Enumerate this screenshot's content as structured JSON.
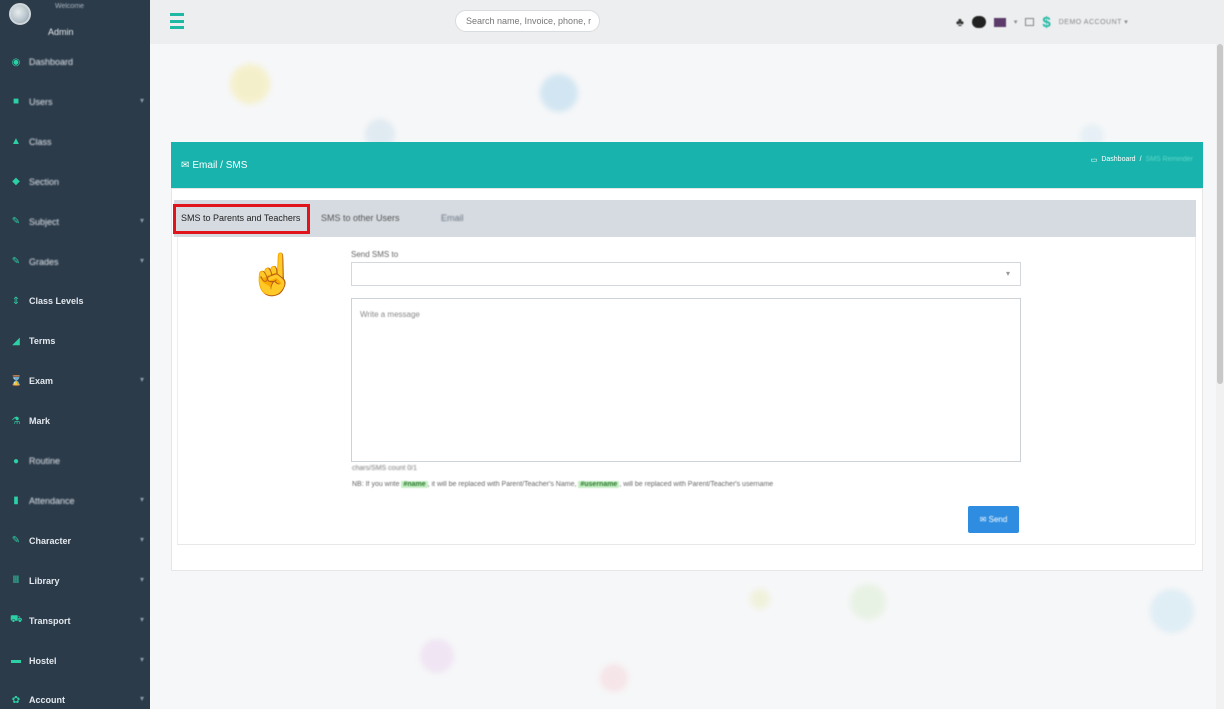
{
  "sidebar": {
    "welcome": "Welcome",
    "user_name": "Admin",
    "items": [
      {
        "label": "Dashboard",
        "icon": "dashboard-icon",
        "glyph": "◉"
      },
      {
        "label": "Users",
        "icon": "users-icon",
        "glyph": "■",
        "chevron": "▾"
      },
      {
        "label": "Class",
        "icon": "class-icon",
        "glyph": "▲"
      },
      {
        "label": "Section",
        "icon": "section-icon",
        "glyph": "◆"
      },
      {
        "label": "Subject",
        "icon": "subject-icon",
        "glyph": "✎",
        "chevron": "▾"
      },
      {
        "label": "Grades",
        "icon": "grades-icon",
        "glyph": "✎",
        "chevron": "▾"
      },
      {
        "label": "Class Levels",
        "icon": "class-levels-icon",
        "glyph": "⇕"
      },
      {
        "label": "Terms",
        "icon": "terms-icon",
        "glyph": "◢"
      },
      {
        "label": "Exam",
        "icon": "exam-icon",
        "glyph": "⌛",
        "chevron": "▾"
      },
      {
        "label": "Mark",
        "icon": "mark-icon",
        "glyph": "⚗"
      },
      {
        "label": "Routine",
        "icon": "routine-icon",
        "glyph": "●"
      },
      {
        "label": "Attendance",
        "icon": "attendance-icon",
        "glyph": "▮",
        "chevron": "▾"
      },
      {
        "label": "Character",
        "icon": "character-icon",
        "glyph": "✎",
        "chevron": "▾"
      },
      {
        "label": "Library",
        "icon": "library-icon",
        "glyph": "Ⅲ",
        "chevron": "▾"
      },
      {
        "label": "Transport",
        "icon": "transport-icon",
        "glyph": "⛟",
        "chevron": "▾"
      },
      {
        "label": "Hostel",
        "icon": "hostel-icon",
        "glyph": "▬",
        "chevron": "▾"
      },
      {
        "label": "Account",
        "icon": "account-icon",
        "glyph": "✿",
        "chevron": "▾"
      }
    ]
  },
  "header": {
    "search_placeholder": "Search name, Invoice, phone, r",
    "account_label": "DEMO ACCOUNT",
    "account_caret": "▾",
    "currency_symbol": "$",
    "bell_glyph": "♣"
  },
  "panel": {
    "title": "Email / SMS",
    "breadcrumb_home": "Dashboard",
    "breadcrumb_sep": "/",
    "breadcrumb_current": "SMS Reminder"
  },
  "tabs": [
    {
      "label": "SMS to Parents and Teachers",
      "active": true
    },
    {
      "label": "SMS to other Users",
      "active": false
    },
    {
      "label": "Email",
      "active": false
    }
  ],
  "form": {
    "send_to_label": "Send SMS to",
    "select_value": "",
    "message_placeholder": "Write a message",
    "char_count": "chars/SMS count 0/1",
    "note_prefix": "NB: If you write",
    "note_token1": "#name",
    "note_mid": ", it will be replaced with Parent/Teacher's Name,",
    "note_token2": "#username",
    "note_suffix": ", will be replaced with Parent/Teacher's username",
    "send_label": "✉ Send"
  },
  "colors": {
    "sidebar_bg": "#2c3b4a",
    "accent": "#18b3ac",
    "highlight": "#e0141a",
    "send_button": "#2e8de0"
  }
}
